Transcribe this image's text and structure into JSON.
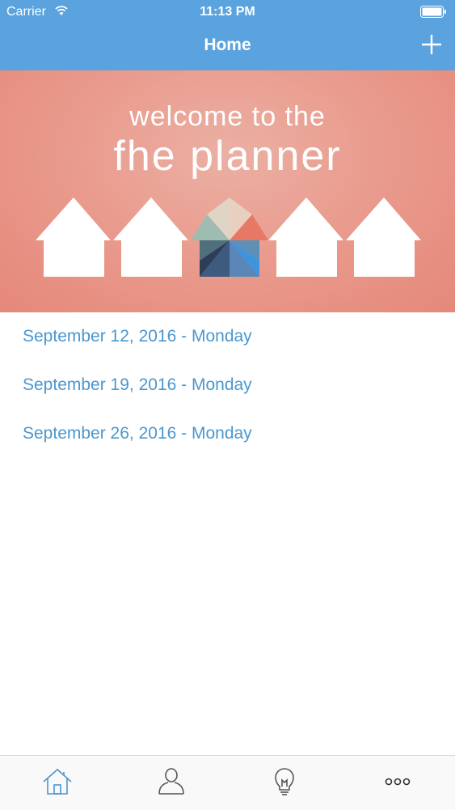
{
  "status_bar": {
    "carrier": "Carrier",
    "time": "11:13 PM"
  },
  "nav": {
    "title": "Home",
    "add_icon": "plus-icon"
  },
  "banner": {
    "line1": "welcome to the",
    "line2": "fhe planner"
  },
  "meetings": [
    {
      "label": "September 12, 2016 - Monday"
    },
    {
      "label": "September 19, 2016 - Monday"
    },
    {
      "label": "September 26, 2016 - Monday"
    }
  ],
  "tab_bar": {
    "tabs": [
      {
        "icon": "home-icon",
        "selected": true
      },
      {
        "icon": "person-icon",
        "selected": false
      },
      {
        "icon": "lightbulb-icon",
        "selected": false
      },
      {
        "icon": "more-icon",
        "selected": false
      }
    ]
  },
  "colors": {
    "accent": "#5aa3df",
    "link": "#4a97cf",
    "banner": "#e99a8c"
  }
}
